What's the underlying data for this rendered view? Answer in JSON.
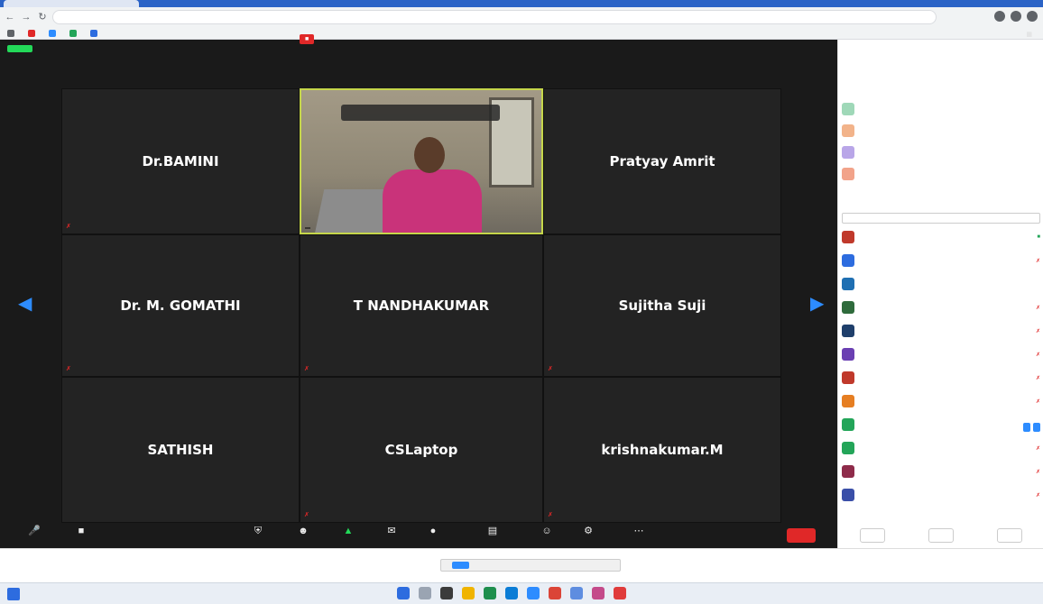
{
  "zoom": {
    "grid_tiles": [
      {
        "name": "Dr.BAMINI"
      },
      {
        "name": "Pratyay Amrit"
      },
      {
        "name": "Dr. M. GOMATHI"
      },
      {
        "name": "T NANDHAKUMAR"
      },
      {
        "name": "Sujitha Suji"
      },
      {
        "name": "SATHISH"
      },
      {
        "name": "CSLaptop"
      },
      {
        "name": "krishnakumar.M"
      }
    ]
  }
}
